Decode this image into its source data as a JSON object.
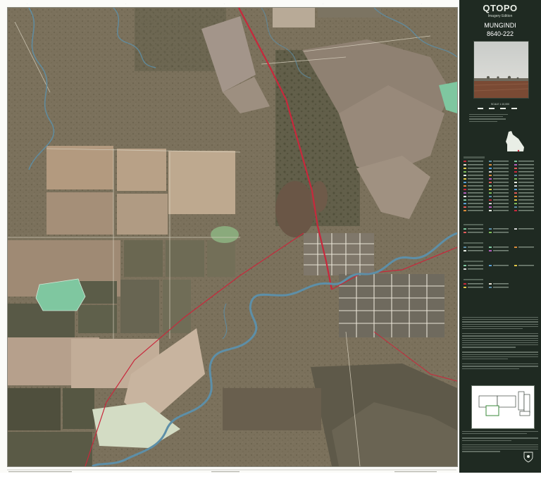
{
  "panel": {
    "brand": "QTOPO",
    "edition": "Imagery Edition",
    "sheet_name": "MUNGINDI",
    "sheet_number": "8640-222",
    "scale": "SCALE 1:10,000"
  },
  "colors": {
    "panel_bg": "#1f2a22",
    "highway": "#c8283c",
    "river": "#5d8fa8",
    "water_body": "#7fc7a0",
    "minor_road": "#e9e4d6"
  },
  "icons": [
    "queensland-locator-icon",
    "scale-bar-icon",
    "coat-of-arms-icon"
  ]
}
